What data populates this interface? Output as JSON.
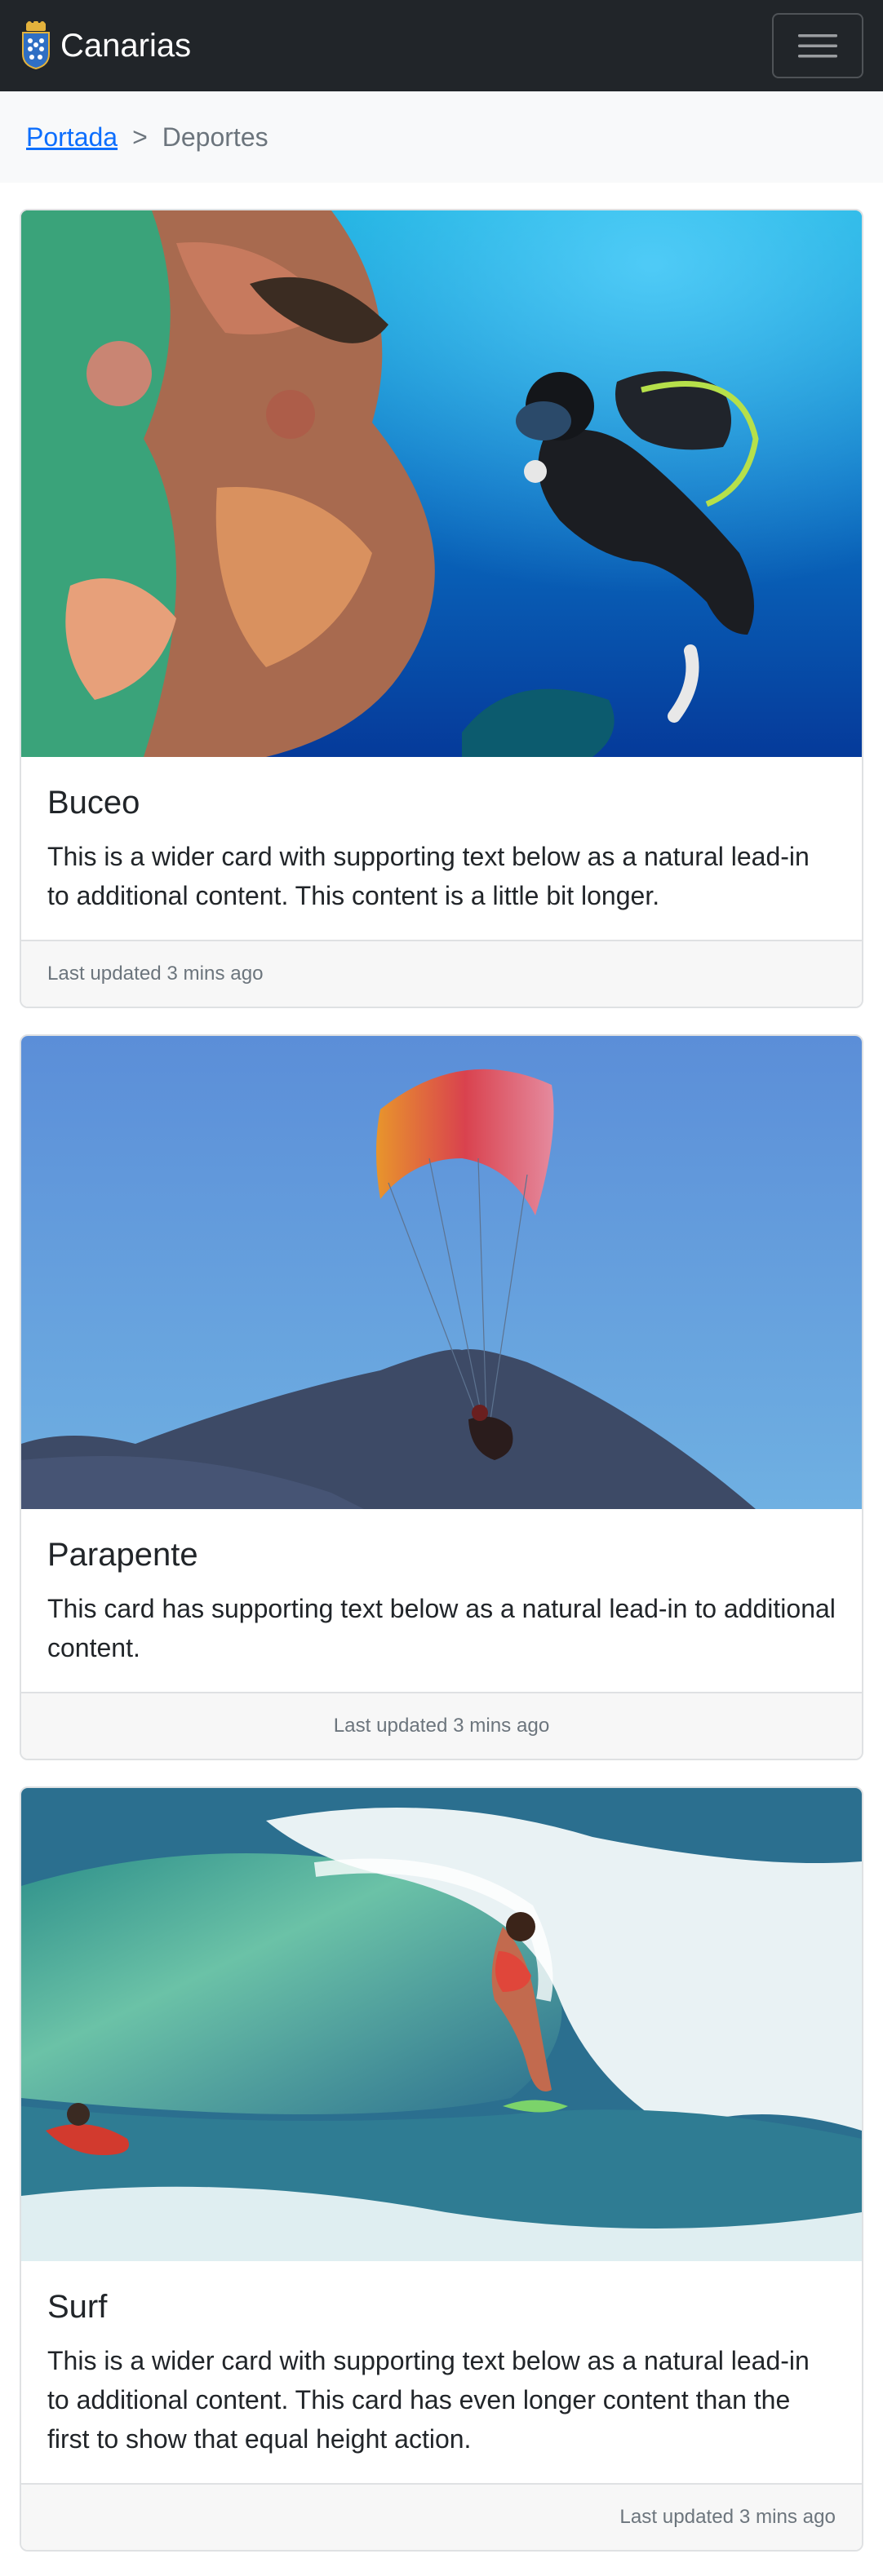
{
  "navbar": {
    "brand": "Canarias",
    "logo_icon": "coat-of-arms-icon",
    "toggler_icon": "hamburger-menu-icon"
  },
  "breadcrumb": {
    "home": "Portada",
    "separator": ">",
    "current": "Deportes"
  },
  "cards": [
    {
      "title": "Buceo",
      "text": "This is a wider card with supporting text below as a natural lead-in to additional content. This content is a little bit longer.",
      "footer": "Last updated 3 mins ago"
    },
    {
      "title": "Parapente",
      "text": "This card has supporting text below as a natural lead-in to additional content.",
      "footer": "Last updated 3 mins ago"
    },
    {
      "title": "Surf",
      "text": "This is a wider card with supporting text below as a natural lead-in to additional content. This card has even longer content than the first to show that equal height action.",
      "footer": "Last updated 3 mins ago"
    }
  ],
  "colors": {
    "navbar_bg": "#212529",
    "link": "#0d6efd",
    "muted": "#6c757d"
  }
}
